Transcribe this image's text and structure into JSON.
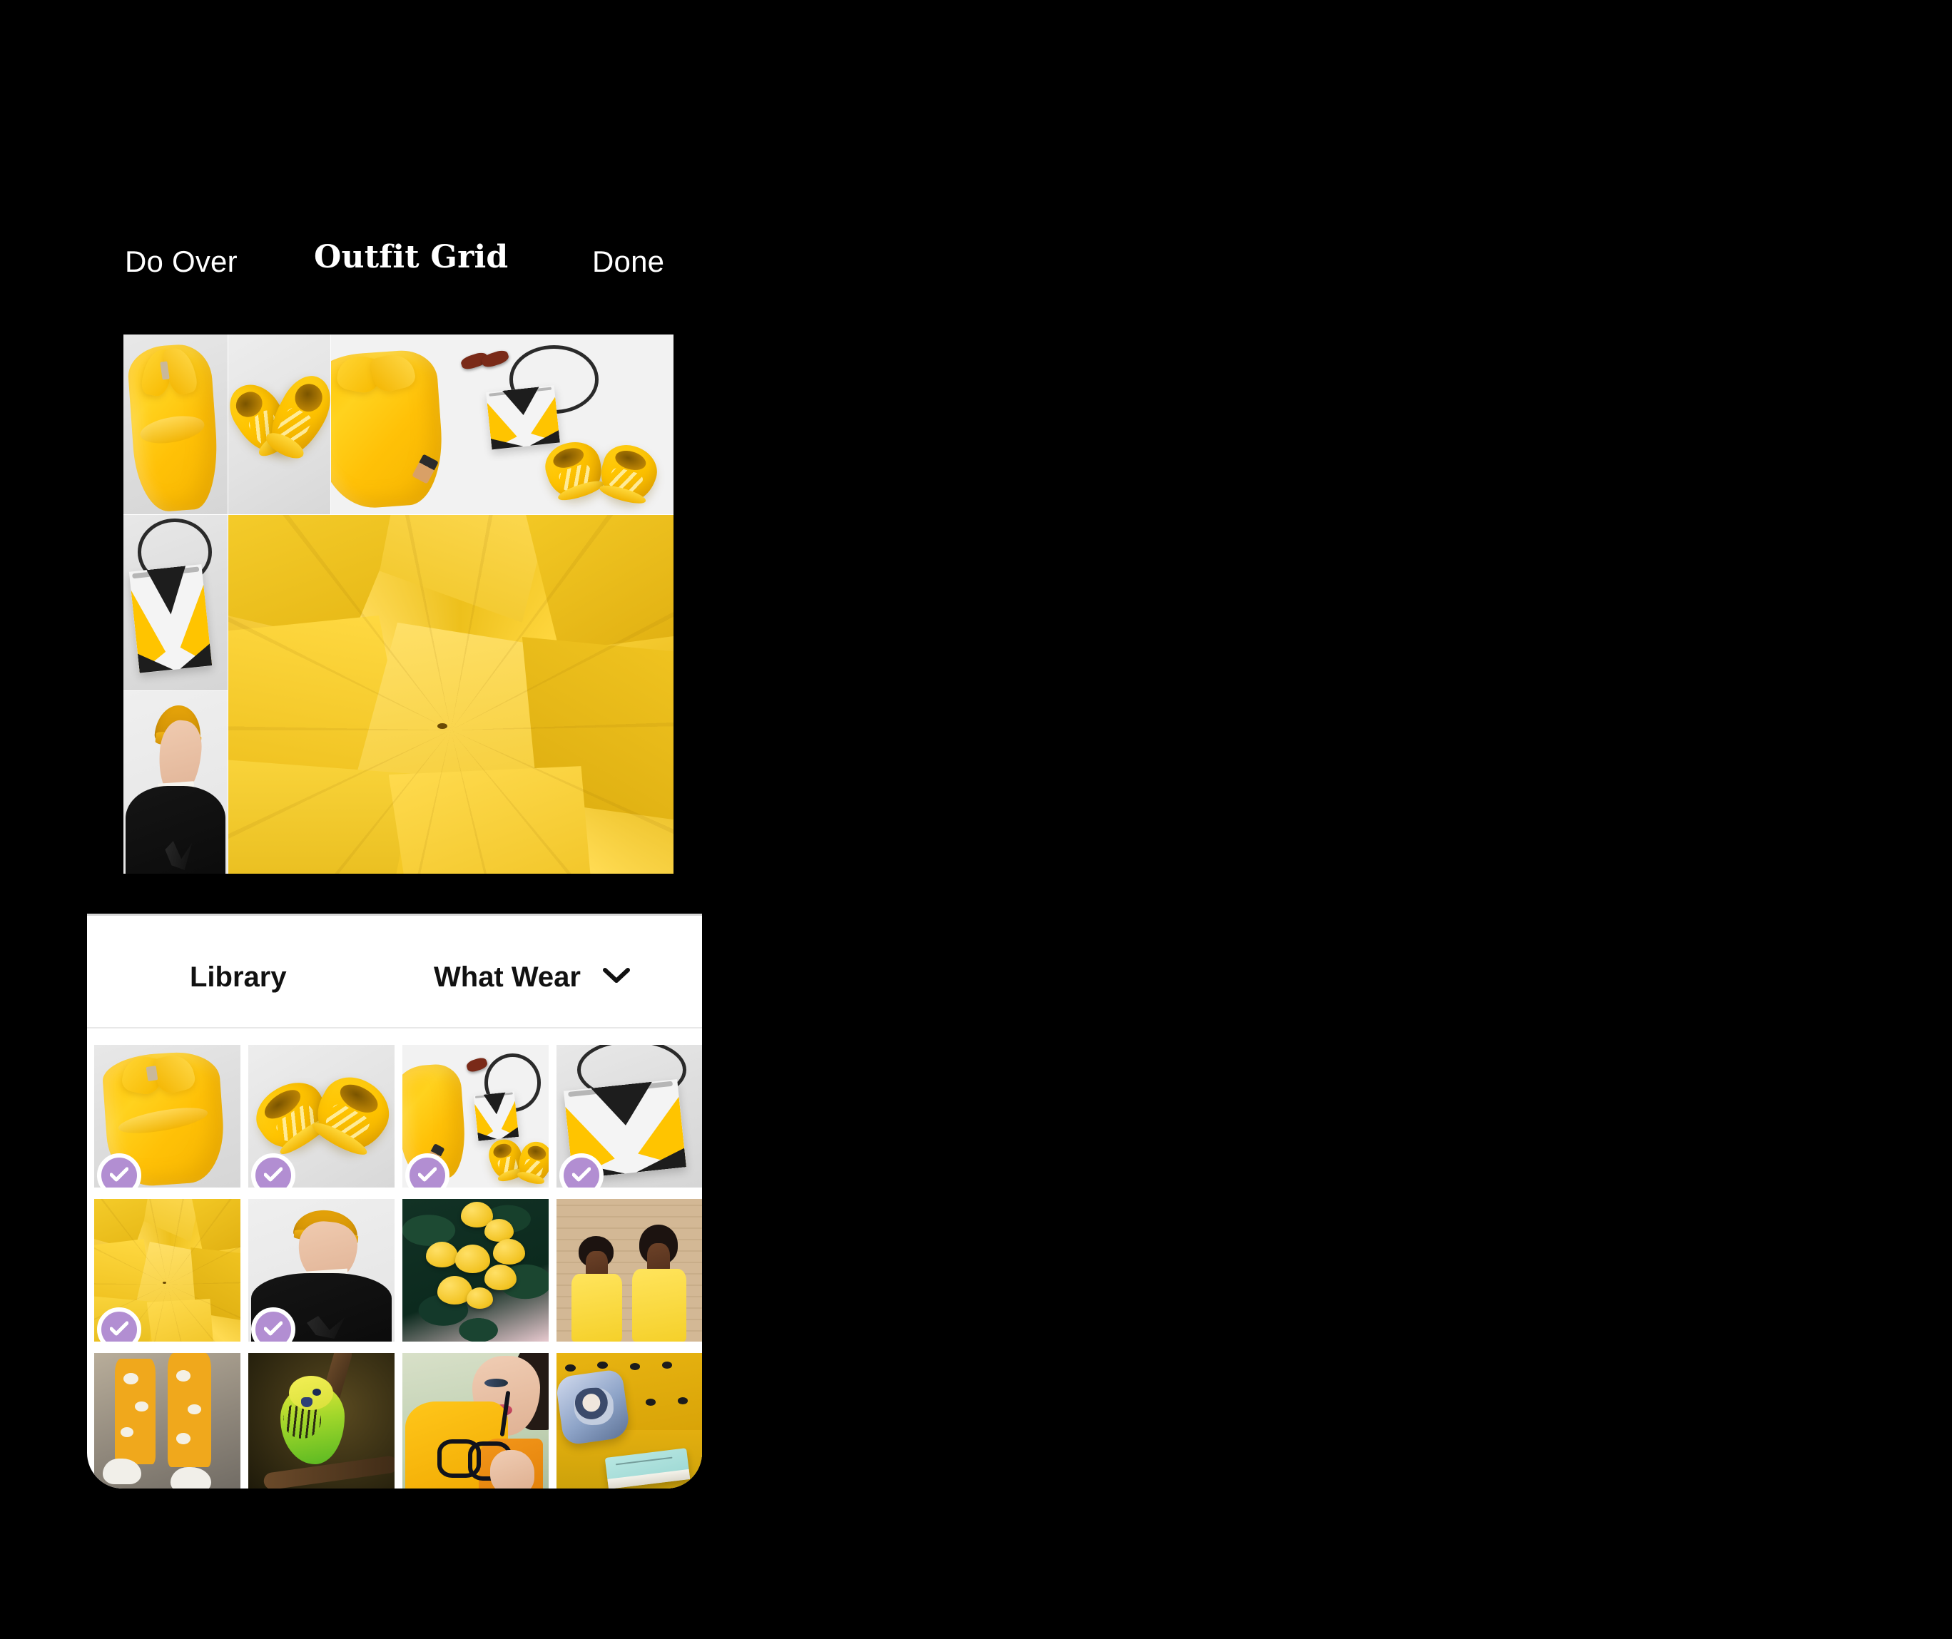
{
  "topbar": {
    "do_over_label": "Do Over",
    "title": "Outfit Grid",
    "done_label": "Done"
  },
  "sheet": {
    "tabs": [
      {
        "label": "Library",
        "active": true
      },
      {
        "label": "What Wear",
        "active": false,
        "icon": "chevron-down-icon"
      }
    ]
  },
  "theme": {
    "background": "#000000",
    "surface": "#ffffff",
    "text_primary": "#ffffff",
    "text_on_surface": "#111111",
    "selection_badge": "#b28ed2",
    "divider": "#e8e8e8",
    "accent_yellow": "#ffc400"
  },
  "outfit_grid": {
    "name": "outfit-collage",
    "cells": [
      {
        "id": "blouse",
        "caption": "Yellow sleeveless blouse flat-lay"
      },
      {
        "id": "sneakers",
        "caption": "Pair of yellow sneakers"
      },
      {
        "id": "flatlay",
        "caption": "Yellow top with sunglasses, bag and sneakers"
      },
      {
        "id": "bag",
        "caption": "Yellow black and white crossbody bag"
      },
      {
        "id": "umbrellas",
        "caption": "Yellow umbrellas close up"
      },
      {
        "id": "beanie",
        "caption": "Man in yellow beanie and black sweater"
      }
    ]
  },
  "library": {
    "items": [
      {
        "id": "blouse",
        "caption": "Yellow sleeveless blouse",
        "selected": true
      },
      {
        "id": "sneakers",
        "caption": "Yellow sneakers",
        "selected": true
      },
      {
        "id": "flatlay",
        "caption": "Yellow outfit flat-lay",
        "selected": true
      },
      {
        "id": "bag",
        "caption": "Yellow crossbody bag",
        "selected": true
      },
      {
        "id": "umbrellas",
        "caption": "Yellow umbrellas",
        "selected": true
      },
      {
        "id": "beanie",
        "caption": "Man in yellow beanie",
        "selected": true
      },
      {
        "id": "lemons",
        "caption": "Lemons on a tree",
        "selected": false
      },
      {
        "id": "dresses",
        "caption": "Two women in yellow dresses",
        "selected": false
      },
      {
        "id": "pants",
        "caption": "Yellow patterned pants",
        "selected": false
      },
      {
        "id": "budgie",
        "caption": "Green and yellow budgie",
        "selected": false
      },
      {
        "id": "sunnies",
        "caption": "Woman in yellow holding glasses",
        "selected": false
      },
      {
        "id": "sofa",
        "caption": "Book on a yellow sofa",
        "selected": false
      }
    ]
  }
}
